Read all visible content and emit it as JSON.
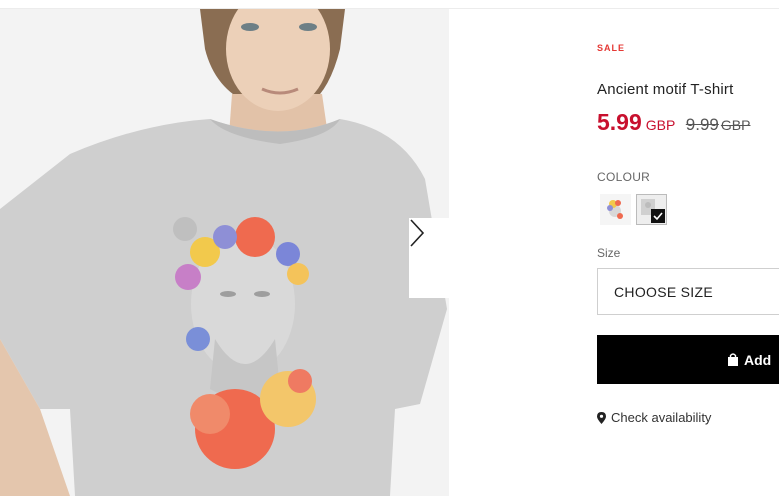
{
  "product": {
    "badge": "SALE",
    "title": "Ancient motif T-shirt",
    "price": "5.99",
    "price_currency": "GBP",
    "old_price": "9.99",
    "old_price_currency": "GBP",
    "sale_color": "#c8102e"
  },
  "gallery": {
    "next_icon": "chevron-right-icon"
  },
  "colour": {
    "label": "COLOUR",
    "swatches": [
      {
        "name": "print-variant-1",
        "selected": false
      },
      {
        "name": "print-variant-2",
        "selected": true
      }
    ]
  },
  "size": {
    "label": "Size",
    "placeholder": "CHOOSE SIZE"
  },
  "add_button": {
    "label": "Add",
    "icon": "shopping-bag-icon"
  },
  "availability": {
    "label": "Check availability",
    "icon": "location-pin-icon"
  }
}
